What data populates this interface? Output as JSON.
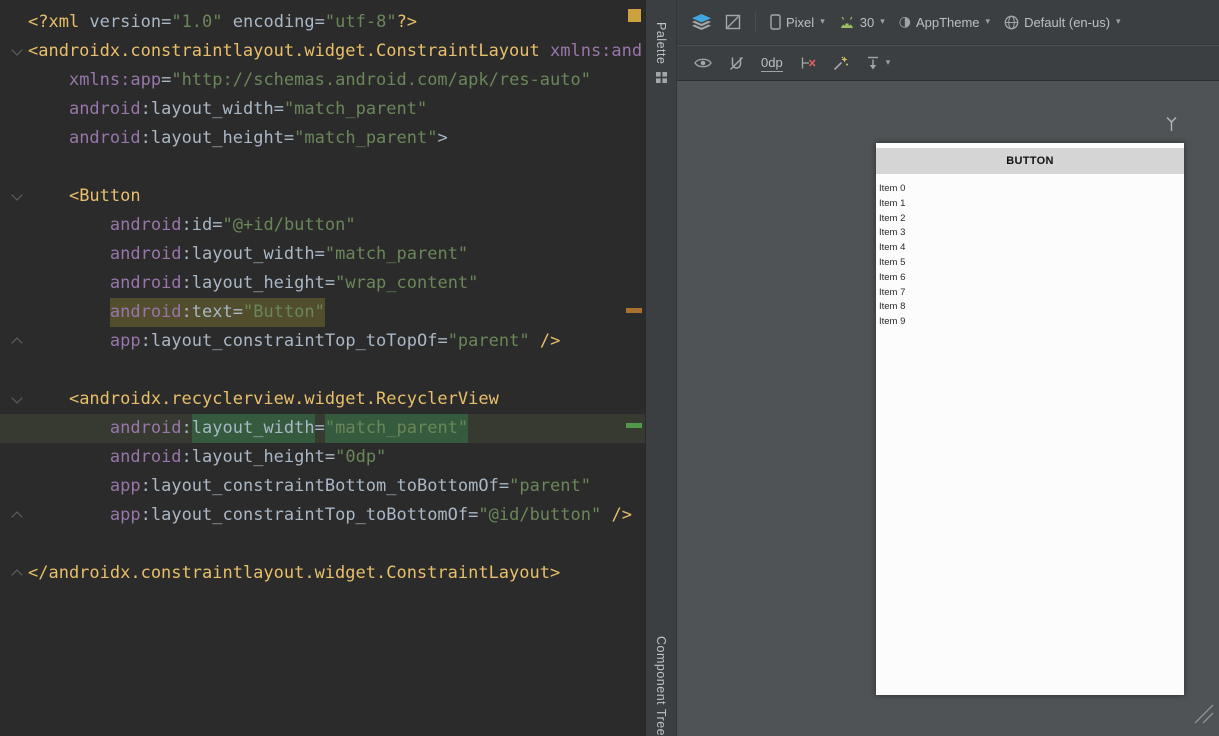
{
  "colors": {
    "editor_bg": "#2b2b2b",
    "xml_tag": "#e8bf6a",
    "xml_namespace": "#9876aa",
    "xml_attribute": "#a9b7c6",
    "xml_string": "#6a8759",
    "selected_attr_highlight": "#514d2d",
    "find_match_highlight": "#355a3d",
    "caret_line": "#373a31",
    "panel_bg": "#3c3f41",
    "surface_bg": "#4f5355",
    "canvas_bg": "#fcfcfc",
    "button_bar": "#d5d5d5",
    "accent_blue": "#3fa7dd",
    "android_green": "#9bc05f",
    "error_stripe_yellow": "#cda23e",
    "stripe_orange": "#a9702e",
    "stripe_green": "#519a4b"
  },
  "editor": {
    "lines": [
      {
        "tokens": [
          {
            "c": "tag",
            "t": "<?xml "
          },
          {
            "c": "attr",
            "t": "version"
          },
          {
            "c": "plain",
            "t": "="
          },
          {
            "c": "str",
            "t": "\"1.0\""
          },
          {
            "c": "plain",
            "t": " "
          },
          {
            "c": "attr",
            "t": "encoding"
          },
          {
            "c": "plain",
            "t": "="
          },
          {
            "c": "str",
            "t": "\"utf-8\""
          },
          {
            "c": "tag",
            "t": "?>"
          }
        ]
      },
      {
        "fold": "open",
        "tokens": [
          {
            "c": "tag",
            "t": "<androidx.constraintlayout.widget.ConstraintLayout"
          },
          {
            "c": "plain",
            "t": " "
          },
          {
            "c": "ns",
            "t": "xmlns:andro"
          }
        ]
      },
      {
        "tokens": [
          {
            "c": "plain",
            "t": "    "
          },
          {
            "c": "ns",
            "t": "xmlns:app"
          },
          {
            "c": "plain",
            "t": "="
          },
          {
            "c": "str",
            "t": "\"http://schemas.android.com/apk/res-auto\""
          }
        ]
      },
      {
        "tokens": [
          {
            "c": "plain",
            "t": "    "
          },
          {
            "c": "ns",
            "t": "android"
          },
          {
            "c": "plain",
            "t": ":"
          },
          {
            "c": "attr",
            "t": "layout_width"
          },
          {
            "c": "plain",
            "t": "="
          },
          {
            "c": "str",
            "t": "\"match_parent\""
          }
        ]
      },
      {
        "tokens": [
          {
            "c": "plain",
            "t": "    "
          },
          {
            "c": "ns",
            "t": "android"
          },
          {
            "c": "plain",
            "t": ":"
          },
          {
            "c": "attr",
            "t": "layout_height"
          },
          {
            "c": "plain",
            "t": "="
          },
          {
            "c": "str",
            "t": "\"match_parent\""
          },
          {
            "c": "plain",
            "t": ">"
          }
        ]
      },
      {
        "tokens": []
      },
      {
        "fold": "open",
        "tokens": [
          {
            "c": "plain",
            "t": "    "
          },
          {
            "c": "tag",
            "t": "<Button"
          }
        ]
      },
      {
        "tokens": [
          {
            "c": "plain",
            "t": "        "
          },
          {
            "c": "ns",
            "t": "android"
          },
          {
            "c": "plain",
            "t": ":"
          },
          {
            "c": "attr",
            "t": "id"
          },
          {
            "c": "plain",
            "t": "="
          },
          {
            "c": "str",
            "t": "\"@+id/button\""
          }
        ]
      },
      {
        "tokens": [
          {
            "c": "plain",
            "t": "        "
          },
          {
            "c": "ns",
            "t": "android"
          },
          {
            "c": "plain",
            "t": ":"
          },
          {
            "c": "attr",
            "t": "layout_width"
          },
          {
            "c": "plain",
            "t": "="
          },
          {
            "c": "str",
            "t": "\"match_parent\""
          }
        ]
      },
      {
        "tokens": [
          {
            "c": "plain",
            "t": "        "
          },
          {
            "c": "ns",
            "t": "android"
          },
          {
            "c": "plain",
            "t": ":"
          },
          {
            "c": "attr",
            "t": "layout_height"
          },
          {
            "c": "plain",
            "t": "="
          },
          {
            "c": "str",
            "t": "\"wrap_content\""
          }
        ]
      },
      {
        "tokens": [
          {
            "c": "plain",
            "t": "        "
          },
          {
            "c": "ns",
            "t": "android",
            "h": "sel"
          },
          {
            "c": "plain",
            "t": ":",
            "h": "sel"
          },
          {
            "c": "attr",
            "t": "text",
            "h": "sel"
          },
          {
            "c": "plain",
            "t": "=",
            "h": "sel"
          },
          {
            "c": "str",
            "t": "\"Button\"",
            "h": "sel"
          }
        ]
      },
      {
        "fold": "close",
        "tokens": [
          {
            "c": "plain",
            "t": "        "
          },
          {
            "c": "ns",
            "t": "app"
          },
          {
            "c": "plain",
            "t": ":"
          },
          {
            "c": "attr",
            "t": "layout_constraintTop_toTopOf"
          },
          {
            "c": "plain",
            "t": "="
          },
          {
            "c": "str",
            "t": "\"parent\""
          },
          {
            "c": "plain",
            "t": " "
          },
          {
            "c": "tag",
            "t": "/>"
          }
        ]
      },
      {
        "tokens": []
      },
      {
        "fold": "open",
        "tokens": [
          {
            "c": "plain",
            "t": "    "
          },
          {
            "c": "tag",
            "t": "<androidx.recyclerview.widget.RecyclerView"
          }
        ]
      },
      {
        "caret": true,
        "tokens": [
          {
            "c": "plain",
            "t": "        "
          },
          {
            "c": "ns",
            "t": "android"
          },
          {
            "c": "plain",
            "t": ":"
          },
          {
            "c": "attr",
            "t": "layout_width",
            "h": "find"
          },
          {
            "c": "plain",
            "t": "="
          },
          {
            "c": "str",
            "t": "\"match_parent\"",
            "h": "find"
          }
        ]
      },
      {
        "tokens": [
          {
            "c": "plain",
            "t": "        "
          },
          {
            "c": "ns",
            "t": "android"
          },
          {
            "c": "plain",
            "t": ":"
          },
          {
            "c": "attr",
            "t": "layout_height"
          },
          {
            "c": "plain",
            "t": "="
          },
          {
            "c": "str",
            "t": "\"0dp\""
          }
        ]
      },
      {
        "tokens": [
          {
            "c": "plain",
            "t": "        "
          },
          {
            "c": "ns",
            "t": "app"
          },
          {
            "c": "plain",
            "t": ":"
          },
          {
            "c": "attr",
            "t": "layout_constraintBottom_toBottomOf"
          },
          {
            "c": "plain",
            "t": "="
          },
          {
            "c": "str",
            "t": "\"parent\""
          }
        ]
      },
      {
        "fold": "close",
        "tokens": [
          {
            "c": "plain",
            "t": "        "
          },
          {
            "c": "ns",
            "t": "app"
          },
          {
            "c": "plain",
            "t": ":"
          },
          {
            "c": "attr",
            "t": "layout_constraintTop_toBottomOf"
          },
          {
            "c": "plain",
            "t": "="
          },
          {
            "c": "str",
            "t": "\"@id/button\""
          },
          {
            "c": "plain",
            "t": " "
          },
          {
            "c": "tag",
            "t": "/>"
          }
        ]
      },
      {
        "tokens": []
      },
      {
        "fold": "close",
        "tokens": [
          {
            "c": "tag",
            "t": "</androidx.constraintlayout.widget.ConstraintLayout>"
          }
        ]
      }
    ]
  },
  "side_strip": {
    "palette_label": "Palette",
    "component_tree_label": "Component Tree"
  },
  "design_toolbar": {
    "device": "Pixel",
    "api_level": "30",
    "theme": "AppTheme",
    "locale": "Default (en-us)",
    "default_margin": "0dp"
  },
  "icons": {
    "chevron_down": "▾",
    "theme_circle": "◑",
    "layers": "layers-stack",
    "blueprint": "slashed-square",
    "device": "phone-outline",
    "android": "droid-head",
    "locale": "globe",
    "view_options": "eye",
    "autoconnect_off": "magnet-slash",
    "clear_constraints": "constraints-red-x",
    "infer_constraints": "magic-wand",
    "pack": "pack-arrow",
    "palette": "grid",
    "antenna": "antenna",
    "resize_grip": "diagonal-lines"
  },
  "preview": {
    "button_label": "BUTTON",
    "items": [
      "Item 0",
      "Item 1",
      "Item 2",
      "Item 3",
      "Item 4",
      "Item 5",
      "Item 6",
      "Item 7",
      "Item 8",
      "Item 9"
    ]
  }
}
